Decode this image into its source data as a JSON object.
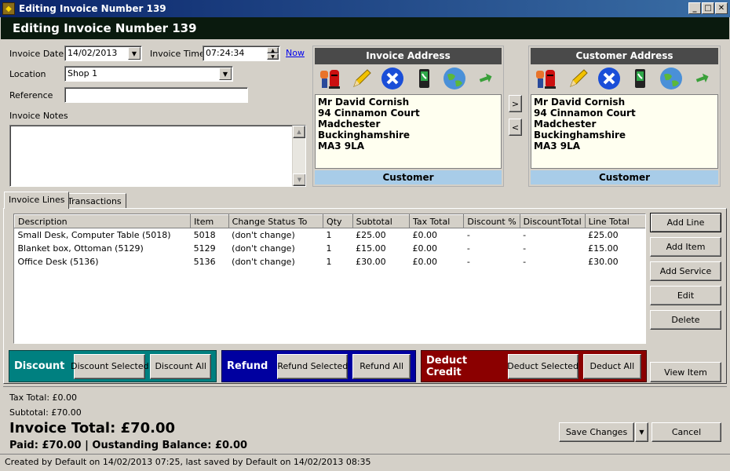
{
  "window": {
    "title": "Editing Invoice Number 139",
    "controls": [
      "_",
      "□",
      "✕"
    ]
  },
  "header": {
    "title": "Editing Invoice Number 139"
  },
  "form": {
    "invoice_date_label": "Invoice Date",
    "invoice_date": "14/02/2013",
    "invoice_time_label": "Invoice Time",
    "invoice_time": "07:24:34",
    "now_link": "Now",
    "location_label": "Location",
    "location": "Shop 1",
    "reference_label": "Reference",
    "reference": "",
    "notes_label": "Invoice Notes",
    "notes": ""
  },
  "invoice_address": {
    "heading": "Invoice Address",
    "lines": [
      "Mr David Cornish",
      "94 Cinnamon Court",
      "Madchester",
      "Buckinghamshire",
      "MA3 9LA"
    ],
    "footer": "Customer"
  },
  "customer_address": {
    "heading": "Customer Address",
    "lines": [
      "Mr David Cornish",
      "94 Cinnamon Court",
      "Madchester",
      "Buckinghamshire",
      "MA3 9LA"
    ],
    "footer": "Customer"
  },
  "copy_buttons": {
    "right": ">",
    "left": "<"
  },
  "tabs": [
    {
      "label": "Invoice Lines",
      "active": true
    },
    {
      "label": "Transactions",
      "active": false
    }
  ],
  "table": {
    "columns": [
      "Description",
      "Item",
      "Change Status To",
      "Qty",
      "Subtotal",
      "Tax Total",
      "Discount %",
      "DiscountTotal",
      "Line Total"
    ],
    "rows": [
      [
        "Small Desk, Computer Table (5018)",
        "5018",
        "(don't change)",
        "1",
        "£25.00",
        "£0.00",
        "-",
        "-",
        "£25.00"
      ],
      [
        "Blanket box, Ottoman (5129)",
        "5129",
        "(don't change)",
        "1",
        "£15.00",
        "£0.00",
        "-",
        "-",
        "£15.00"
      ],
      [
        "Office Desk (5136)",
        "5136",
        "(don't change)",
        "1",
        "£30.00",
        "£0.00",
        "-",
        "-",
        "£30.00"
      ]
    ]
  },
  "side_buttons": {
    "add_line": "Add Line",
    "add_item": "Add Item",
    "add_service": "Add Service",
    "edit": "Edit",
    "delete": "Delete",
    "view_item": "View Item"
  },
  "discount": {
    "label": "Discount",
    "selected": "Discount Selected",
    "all": "Discount All",
    "color": "#008080"
  },
  "refund": {
    "label": "Refund",
    "selected": "Refund Selected",
    "all": "Refund All",
    "color": "#0000a0"
  },
  "deduct": {
    "label": "Deduct Credit",
    "selected": "Deduct Selected",
    "all": "Deduct All",
    "color": "#8b0000"
  },
  "totals": {
    "tax_total": "Tax Total: £0.00",
    "subtotal": "Subtotal: £70.00",
    "invoice_total": "Invoice Total: £70.00",
    "paid_line": "Paid: £70.00 | Oustanding Balance: £0.00"
  },
  "footer_buttons": {
    "save": "Save Changes",
    "cancel": "Cancel"
  },
  "status": "Created by Default on 14/02/2013 07:25, last saved by Default on 14/02/2013 08:35"
}
